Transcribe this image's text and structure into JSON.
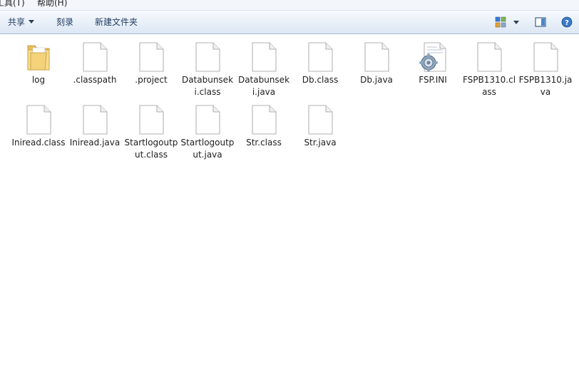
{
  "menubar": {
    "items": [
      {
        "label": "工具(T)"
      },
      {
        "label": "帮助(H)"
      }
    ]
  },
  "toolbar": {
    "share_label": "共享",
    "burn_label": "刻录",
    "new_folder_label": "新建文件夹",
    "view_icon": "view-options-icon",
    "preview_icon": "preview-pane-icon",
    "help_icon": "help-icon"
  },
  "files": [
    {
      "name": "log",
      "label": "log",
      "icon": "folder-icon"
    },
    {
      "name": ".classpath",
      "label": ".classpath",
      "icon": "file-icon"
    },
    {
      "name": ".project",
      "label": ".project",
      "icon": "file-icon"
    },
    {
      "name": "Databunseki.class",
      "label": "Databunseki.class",
      "icon": "file-icon"
    },
    {
      "name": "Databunseki.java",
      "label": "Databunseki.java",
      "icon": "file-icon"
    },
    {
      "name": "Db.class",
      "label": "Db.class",
      "icon": "file-icon"
    },
    {
      "name": "Db.java",
      "label": "Db.java",
      "icon": "file-icon"
    },
    {
      "name": "FSP.INI",
      "label": "FSP.INI",
      "icon": "settings-file-icon"
    },
    {
      "name": "FSPB1310.class",
      "label": "FSPB1310.class",
      "icon": "file-icon"
    },
    {
      "name": "FSPB1310.java",
      "label": "FSPB1310.java",
      "icon": "file-icon"
    },
    {
      "name": "Iniread.class",
      "label": "Iniread.class",
      "icon": "file-icon"
    },
    {
      "name": "Iniread.java",
      "label": "Iniread.java",
      "icon": "file-icon"
    },
    {
      "name": "Startlogoutput.class",
      "label": "Startlogoutput.class",
      "icon": "file-icon"
    },
    {
      "name": "Startlogoutput.java",
      "label": "Startlogoutput.java",
      "icon": "file-icon"
    },
    {
      "name": "Str.class",
      "label": "Str.class",
      "icon": "file-icon"
    },
    {
      "name": "Str.java",
      "label": "Str.java",
      "icon": "file-icon"
    }
  ],
  "colors": {
    "toolbar_text": "#1e3a5f",
    "toolbar_border": "#a9bcd6",
    "folder": "#e9c46a"
  }
}
